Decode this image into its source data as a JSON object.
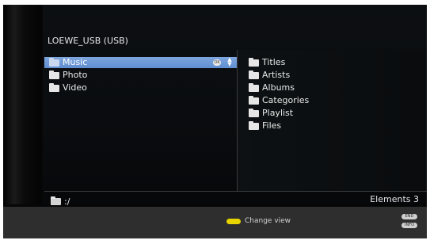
{
  "header": {
    "title": "LOEWE_USB (USB)"
  },
  "left_list": {
    "items": [
      {
        "label": "Music",
        "selected": true
      },
      {
        "label": "Photo",
        "selected": false
      },
      {
        "label": "Video",
        "selected": false
      }
    ],
    "ok_icon": "OK",
    "updown_icon": "up-down-arrows"
  },
  "right_list": {
    "items": [
      {
        "label": "Titles"
      },
      {
        "label": "Artists"
      },
      {
        "label": "Albums"
      },
      {
        "label": "Categories"
      },
      {
        "label": "Playlist"
      },
      {
        "label": "Files"
      }
    ]
  },
  "status": {
    "path": ":/",
    "elements": "Elements 3"
  },
  "footer": {
    "change_view": "Change view",
    "end_label": "END",
    "info_label": "INFO",
    "yellow_color": "#e8d400",
    "selection_color": "#6f9ad8"
  }
}
